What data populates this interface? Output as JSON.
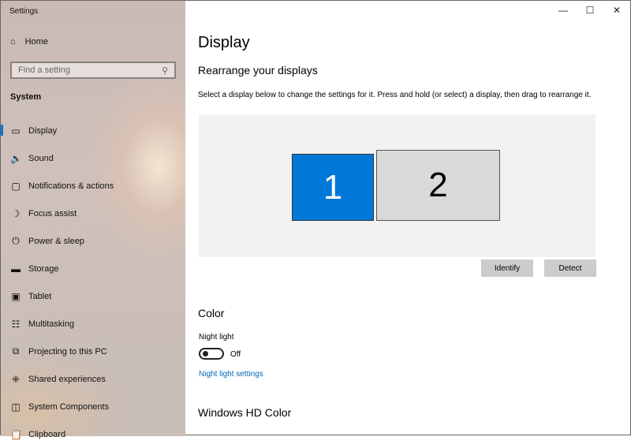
{
  "app_title": "Settings",
  "sidebar": {
    "home": "Home",
    "search_placeholder": "Find a setting",
    "section": "System",
    "items": [
      {
        "label": "Display",
        "icon": "monitor-icon",
        "glyph": "▭"
      },
      {
        "label": "Sound",
        "icon": "speaker-icon",
        "glyph": "🔈"
      },
      {
        "label": "Notifications & actions",
        "icon": "notification-icon",
        "glyph": "▢"
      },
      {
        "label": "Focus assist",
        "icon": "moon-icon",
        "glyph": "☽"
      },
      {
        "label": "Power & sleep",
        "icon": "power-icon",
        "glyph": "⏻"
      },
      {
        "label": "Storage",
        "icon": "storage-icon",
        "glyph": "▬"
      },
      {
        "label": "Tablet",
        "icon": "tablet-icon",
        "glyph": "▣"
      },
      {
        "label": "Multitasking",
        "icon": "multitasking-icon",
        "glyph": "☷"
      },
      {
        "label": "Projecting to this PC",
        "icon": "projecting-icon",
        "glyph": "⧉"
      },
      {
        "label": "Shared experiences",
        "icon": "shared-experiences-icon",
        "glyph": "⁜"
      },
      {
        "label": "System Components",
        "icon": "components-icon",
        "glyph": "◫"
      },
      {
        "label": "Clipboard",
        "icon": "clipboard-icon",
        "glyph": "📋"
      }
    ]
  },
  "main": {
    "title": "Display",
    "rearrange_heading": "Rearrange your displays",
    "rearrange_desc": "Select a display below to change the settings for it. Press and hold (or select) a display, then drag to rearrange it.",
    "monitor1": "1",
    "monitor2": "2",
    "identify": "Identify",
    "detect": "Detect",
    "color_heading": "Color",
    "night_light_label": "Night light",
    "night_light_state": "Off",
    "night_light_link": "Night light settings",
    "hd_heading": "Windows HD Color"
  }
}
